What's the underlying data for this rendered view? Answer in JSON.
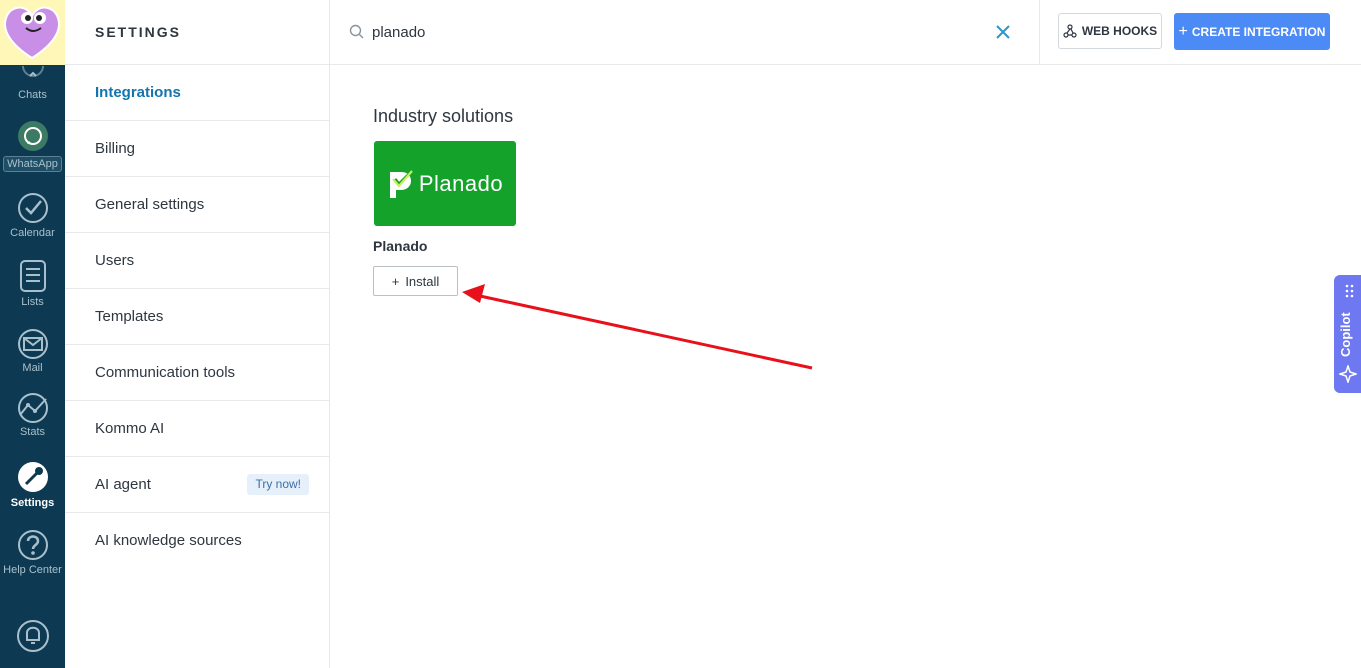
{
  "nav": {
    "items": [
      {
        "label": "Chats",
        "icon": "chats-icon"
      },
      {
        "label": "WhatsApp",
        "icon": "whatsapp-icon"
      },
      {
        "label": "Calendar",
        "icon": "calendar-icon"
      },
      {
        "label": "Lists",
        "icon": "lists-icon"
      },
      {
        "label": "Mail",
        "icon": "mail-icon"
      },
      {
        "label": "Stats",
        "icon": "stats-icon"
      },
      {
        "label": "Settings",
        "icon": "settings-icon"
      },
      {
        "label": "Help Center",
        "icon": "help-icon"
      }
    ],
    "active": "Settings"
  },
  "sidebar": {
    "title": "SETTINGS",
    "items": [
      {
        "label": "Integrations"
      },
      {
        "label": "Billing"
      },
      {
        "label": "General settings"
      },
      {
        "label": "Users"
      },
      {
        "label": "Templates"
      },
      {
        "label": "Communication tools"
      },
      {
        "label": "Kommo AI"
      },
      {
        "label": "AI agent",
        "badge": "Try now!"
      },
      {
        "label": "AI knowledge sources"
      }
    ],
    "active": "Integrations"
  },
  "search": {
    "value": "planado"
  },
  "toolbar": {
    "webhooks_label": "WEB HOOKS",
    "create_label": "CREATE INTEGRATION",
    "create_plus": "+"
  },
  "main": {
    "section_title": "Industry solutions",
    "integration": {
      "brand": "Planado",
      "name": "Planado",
      "install_label": "Install",
      "install_plus": "+"
    }
  },
  "copilot": {
    "label": "Copilot"
  },
  "colors": {
    "nav_bg": "#0d3a52",
    "accent_blue": "#4c8bf5",
    "active_link": "#1375ab",
    "tile_green": "#15a22b",
    "copilot": "#6e78f0",
    "annotation_arrow": "#e8111b"
  }
}
